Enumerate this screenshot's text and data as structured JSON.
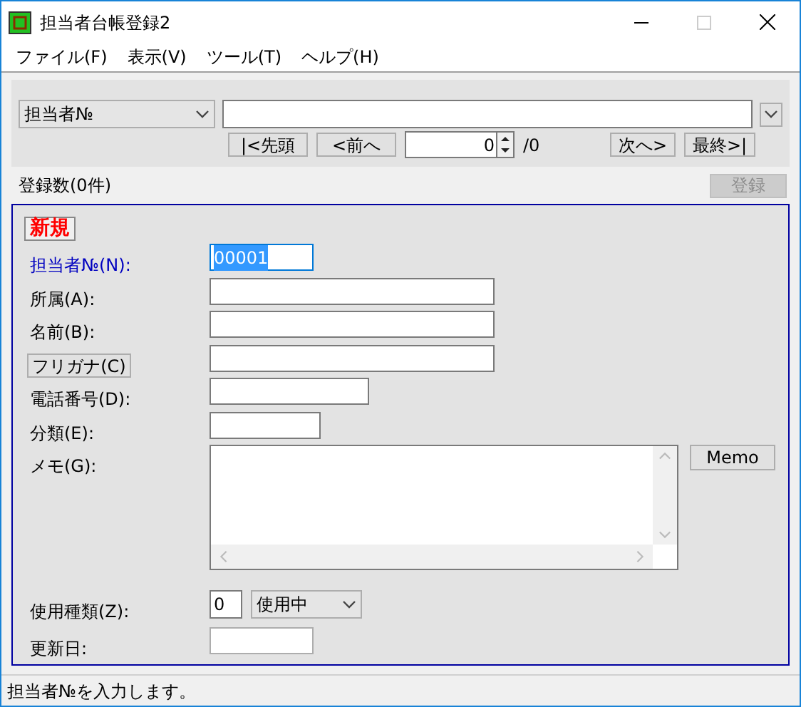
{
  "window": {
    "title": "担当者台帳登録2"
  },
  "menu": [
    "ファイル(F)",
    "表示(V)",
    "ツール(T)",
    "ヘルプ(H)"
  ],
  "search": {
    "field_select": "担当者№",
    "nav": [
      "|<先頭",
      "<前へ"
    ],
    "page": "0",
    "total": "/0",
    "nav_right": [
      "次へ>",
      "最終>|"
    ]
  },
  "count": "登録数(0件)",
  "register_button": {
    "label": "登録",
    "disabled": true
  },
  "form": {
    "badge": "新規",
    "rows": [
      {
        "kind": "code",
        "label": "担当者№(N):",
        "focused": true,
        "value": "00001",
        "selected_text": true
      },
      {
        "kind": "long",
        "label": "所属(A):",
        "focused": false
      },
      {
        "kind": "long",
        "label": "名前(B):",
        "focused": false
      },
      {
        "kind": "button",
        "label": "フリガナ(C)",
        "focused": false
      },
      {
        "kind": "medium",
        "label": "電話番号(D):",
        "focused": false
      },
      {
        "kind": "short",
        "label": "分類(E):",
        "focused": false
      },
      {
        "kind": "memo",
        "label": "メモ(G):",
        "focused": false,
        "side_button": "Memo"
      },
      {
        "kind": "usage",
        "label": "使用種類(Z):",
        "focused": false,
        "value": "0",
        "option": "使用中"
      },
      {
        "kind": "readonly",
        "label": "更新日:",
        "focused": false
      }
    ]
  },
  "status_bar": "担当者№を入力します。"
}
